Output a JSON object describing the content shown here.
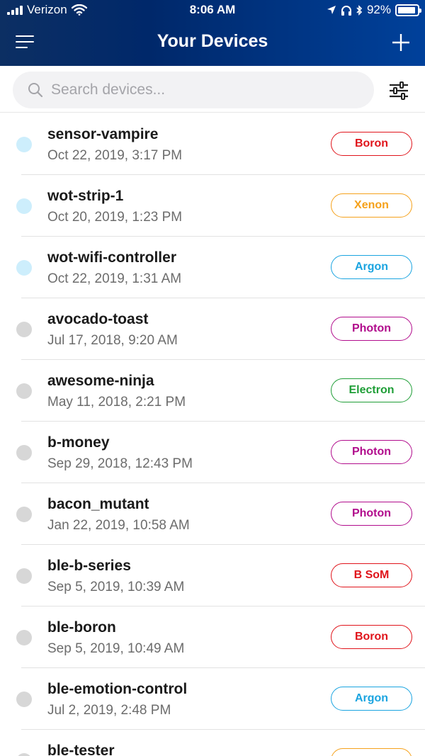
{
  "status_bar": {
    "carrier": "Verizon",
    "time": "8:06 AM",
    "battery_percent": "92%",
    "battery_level": 0.92,
    "icons": [
      "signal-icon",
      "wifi-icon",
      "location-icon",
      "headphones-icon",
      "bluetooth-icon",
      "battery-icon"
    ]
  },
  "nav": {
    "title": "Your Devices",
    "icons": [
      "menu-icon",
      "plus-icon"
    ]
  },
  "search": {
    "placeholder": "Search devices...",
    "value": "",
    "icons": [
      "search-icon",
      "filter-icon"
    ]
  },
  "colors": {
    "header_start": "#0c2f63",
    "header_end": "#00419b",
    "online_dot": "#cdeefc",
    "offline_dot": "#d7d7d7"
  },
  "badge_colors": {
    "Boron": "#e0141b",
    "B SoM": "#e0141b",
    "Xenon": "#f5a11b",
    "Argon": "#1aa4e0",
    "Photon": "#b10c8c",
    "Electron": "#1f9e37"
  },
  "devices": [
    {
      "name": "sensor-vampire",
      "date": "Oct 22, 2019, 3:17 PM",
      "type": "Boron",
      "online": true
    },
    {
      "name": "wot-strip-1",
      "date": "Oct 20, 2019, 1:23 PM",
      "type": "Xenon",
      "online": true
    },
    {
      "name": "wot-wifi-controller",
      "date": "Oct 22, 2019, 1:31 AM",
      "type": "Argon",
      "online": true
    },
    {
      "name": "avocado-toast",
      "date": "Jul 17, 2018, 9:20 AM",
      "type": "Photon",
      "online": false
    },
    {
      "name": "awesome-ninja",
      "date": "May 11, 2018, 2:21 PM",
      "type": "Electron",
      "online": false
    },
    {
      "name": "b-money",
      "date": "Sep 29, 2018, 12:43 PM",
      "type": "Photon",
      "online": false
    },
    {
      "name": "bacon_mutant",
      "date": "Jan 22, 2019, 10:58 AM",
      "type": "Photon",
      "online": false
    },
    {
      "name": "ble-b-series",
      "date": "Sep 5, 2019, 10:39 AM",
      "type": "B SoM",
      "online": false
    },
    {
      "name": "ble-boron",
      "date": "Sep 5, 2019, 10:49 AM",
      "type": "Boron",
      "online": false
    },
    {
      "name": "ble-emotion-control",
      "date": "Jul 2, 2019, 2:48 PM",
      "type": "Argon",
      "online": false
    },
    {
      "name": "ble-tester",
      "date": "",
      "type": "",
      "online": false
    }
  ]
}
